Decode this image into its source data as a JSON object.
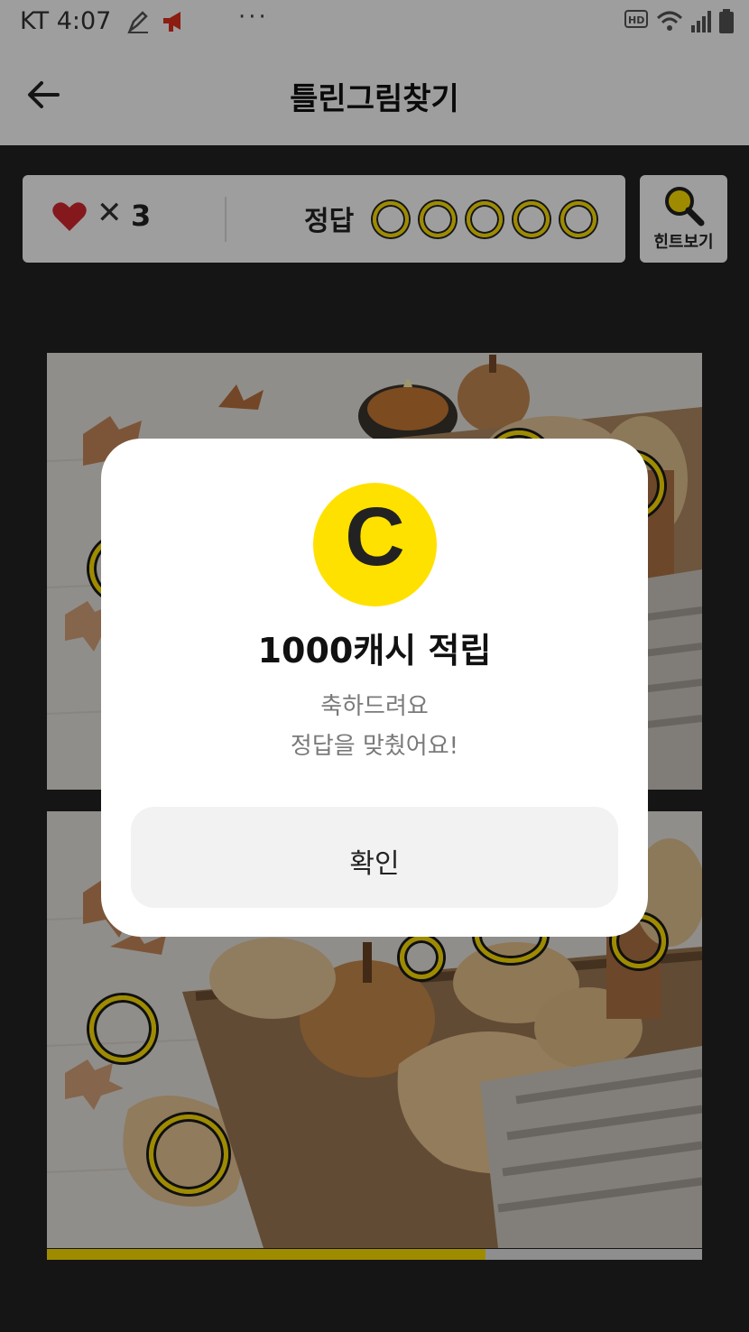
{
  "status_bar": {
    "carrier": "KT",
    "time": "4:07",
    "dots": "···"
  },
  "header": {
    "title": "틀린그림찾기"
  },
  "score_panel": {
    "times_symbol": "✕",
    "lives": "3",
    "answer_label": "정답",
    "answer_total": 5,
    "hint_label": "힌트보기"
  },
  "progress": {
    "fraction": 0.67
  },
  "modal": {
    "coin_letter": "C",
    "title": "1000캐시 적립",
    "message_line1": "축하드려요",
    "message_line2": "정답을 맞췄어요!",
    "confirm_label": "확인"
  },
  "colors": {
    "accent": "#ffe100",
    "heart": "#d7282f",
    "dark": "#222222"
  },
  "icons": [
    "back-arrow-icon",
    "heart-icon",
    "magnifier-icon",
    "wifi-icon",
    "signal-icon",
    "battery-icon",
    "megaphone-icon",
    "pen-icon",
    "hd-icon"
  ]
}
